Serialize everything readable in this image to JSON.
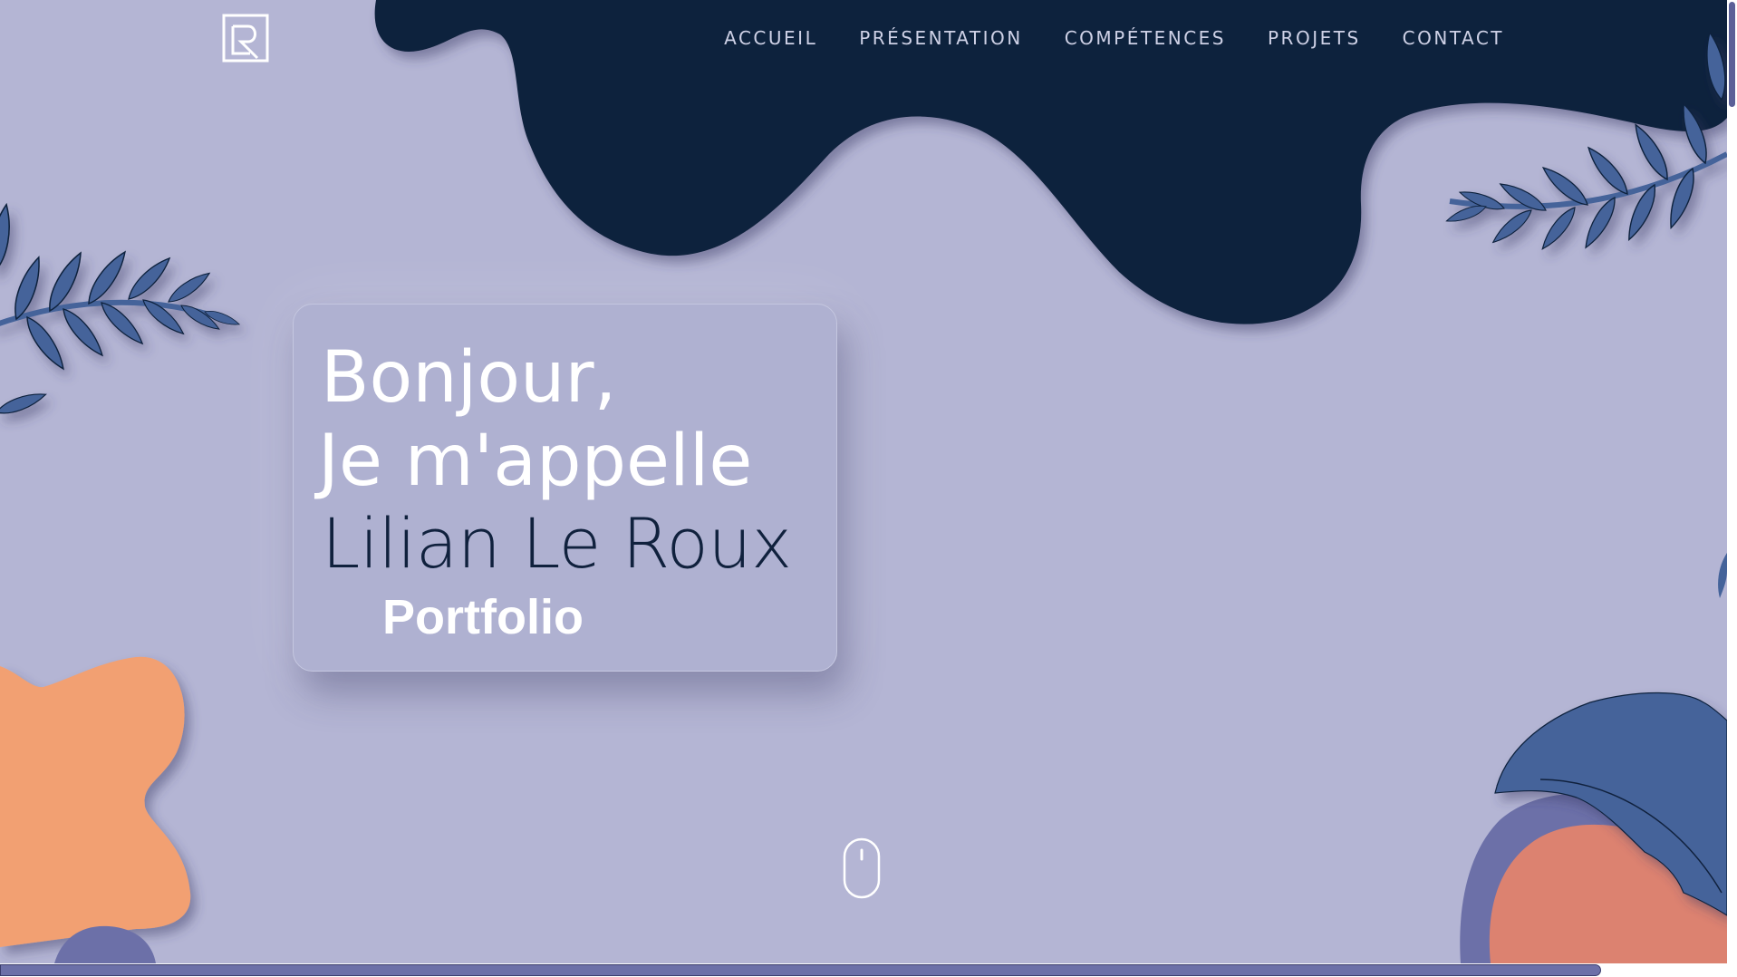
{
  "nav": {
    "logo_icon": "lr-monogram-logo",
    "items": [
      {
        "label": "ACCUEIL"
      },
      {
        "label": "PRÉSENTATION"
      },
      {
        "label": "COMPÉTENCES"
      },
      {
        "label": "PROJETS"
      },
      {
        "label": "CONTACT"
      }
    ]
  },
  "hero": {
    "greeting_line1": "Bonjour,",
    "greeting_line2": "Je m'appelle",
    "name": "Lilian Le Roux",
    "subtitle": "Portfolio",
    "scroll_icon": "mouse-scroll-icon"
  },
  "page_progress": {
    "fraction": 0.922
  },
  "scrollbar": {
    "position_fraction": 0.0
  },
  "colors": {
    "background": "#b4b5d4",
    "navy": "#10213d",
    "leaf_blue": "#44639a",
    "orange": "#f2a072",
    "coral": "#dc8270",
    "purple": "#6c70a8",
    "nav_text": "#ced1e6",
    "white": "#ffffff"
  }
}
